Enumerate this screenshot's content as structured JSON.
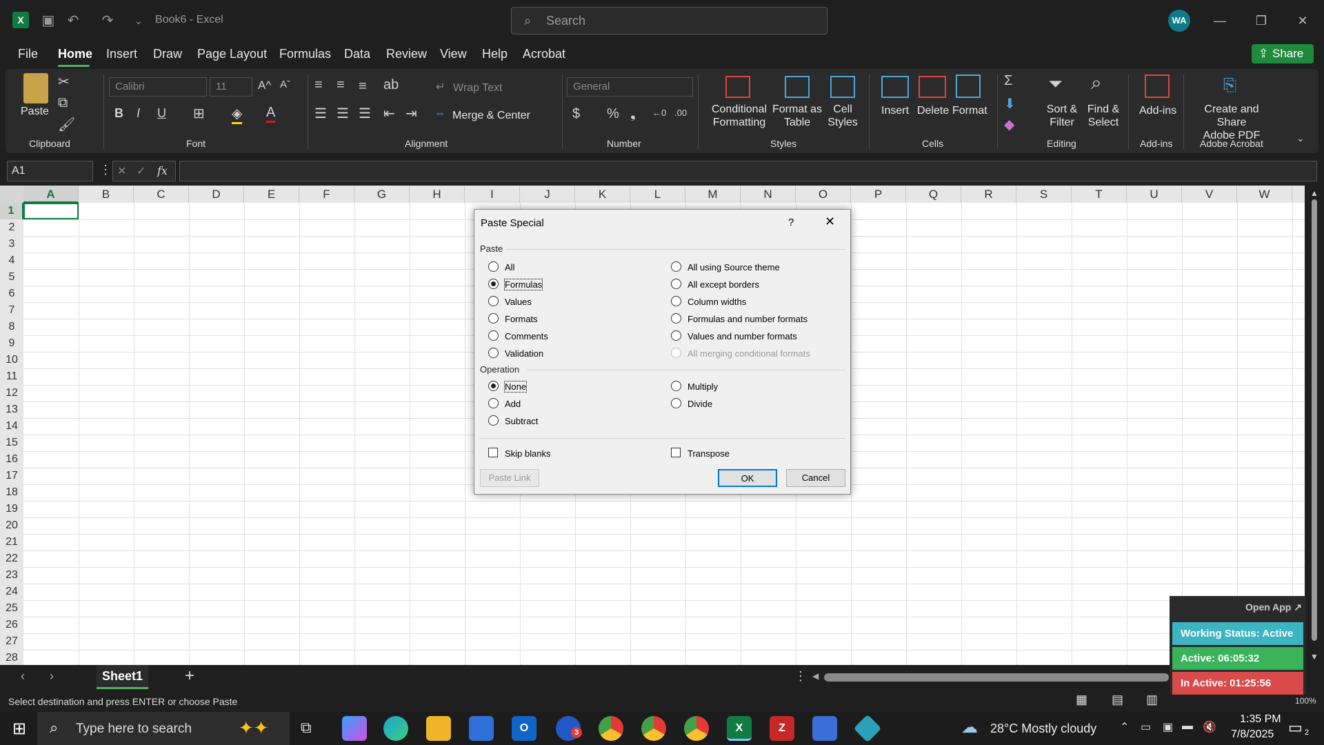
{
  "titlebar": {
    "doc_title": "Book6 - Excel",
    "search_placeholder": "Search",
    "avatar": "WA",
    "share": "Share"
  },
  "menu": {
    "tabs": [
      "File",
      "Home",
      "Insert",
      "Draw",
      "Page Layout",
      "Formulas",
      "Data",
      "Review",
      "View",
      "Help",
      "Acrobat"
    ],
    "active": "Home"
  },
  "ribbon": {
    "clipboard": {
      "paste": "Paste",
      "group": "Clipboard"
    },
    "font": {
      "font_name": "Calibri",
      "font_size": "11",
      "group": "Font"
    },
    "alignment": {
      "wrap_text": "Wrap Text",
      "merge_center": "Merge & Center",
      "group": "Alignment"
    },
    "number": {
      "format": "General",
      "group": "Number"
    },
    "styles": {
      "conditional": [
        "Conditional",
        "Formatting"
      ],
      "format_table": [
        "Format as",
        "Table"
      ],
      "cell_styles": [
        "Cell",
        "Styles"
      ],
      "group": "Styles"
    },
    "cells": {
      "insert": "Insert",
      "delete": "Delete",
      "format": "Format",
      "group": "Cells"
    },
    "editing": {
      "sort": [
        "Sort &",
        "Filter"
      ],
      "find": [
        "Find &",
        "Select"
      ],
      "group": "Editing"
    },
    "addins": {
      "label": "Add-ins",
      "group": "Add-ins"
    },
    "acrobat": {
      "label": [
        "Create and Share",
        "Adobe PDF"
      ],
      "group": "Adobe Acrobat"
    }
  },
  "formula_bar": {
    "name_box": "A1",
    "fx": "fx",
    "value": ""
  },
  "grid": {
    "columns": [
      "A",
      "B",
      "C",
      "D",
      "E",
      "F",
      "G",
      "H",
      "I",
      "J",
      "K",
      "L",
      "M",
      "N",
      "O",
      "P",
      "Q",
      "R",
      "S",
      "T",
      "U",
      "V",
      "W"
    ],
    "rows": [
      "1",
      "2",
      "3",
      "4",
      "5",
      "6",
      "7",
      "8",
      "9",
      "10",
      "11",
      "12",
      "13",
      "14",
      "15",
      "16",
      "17",
      "18",
      "19",
      "20",
      "21",
      "22",
      "23",
      "24",
      "25",
      "26",
      "27",
      "28"
    ]
  },
  "dialog": {
    "title": "Paste Special",
    "help": "?",
    "paste_section": "Paste",
    "paste_left": [
      "All",
      "Formulas",
      "Values",
      "Formats",
      "Comments",
      "Validation"
    ],
    "paste_right": [
      "All using Source theme",
      "All except borders",
      "Column widths",
      "Formulas and number formats",
      "Values and number formats",
      "All merging conditional formats"
    ],
    "paste_selected": "Formulas",
    "operation_section": "Operation",
    "operation_left": [
      "None",
      "Add",
      "Subtract"
    ],
    "operation_right": [
      "Multiply",
      "Divide"
    ],
    "operation_selected": "None",
    "skip_blanks": "Skip blanks",
    "transpose": "Transpose",
    "paste_link": "Paste Link",
    "ok": "OK",
    "cancel": "Cancel"
  },
  "sheets": {
    "tabs": [
      "Sheet1"
    ]
  },
  "status": {
    "message": "Select destination and press ENTER or choose Paste",
    "zoom": "100%"
  },
  "widget": {
    "open_app": "Open App ↗",
    "working_status": "Working Status: Active",
    "active": "Active: 06:05:32",
    "inactive": "In Active: 01:25:56"
  },
  "taskbar": {
    "search_placeholder": "Type here to search",
    "weather": "28°C  Mostly cloudy",
    "time": "1:35 PM",
    "date": "7/8/2025",
    "notif_count": "2",
    "mail_badge": "3"
  }
}
